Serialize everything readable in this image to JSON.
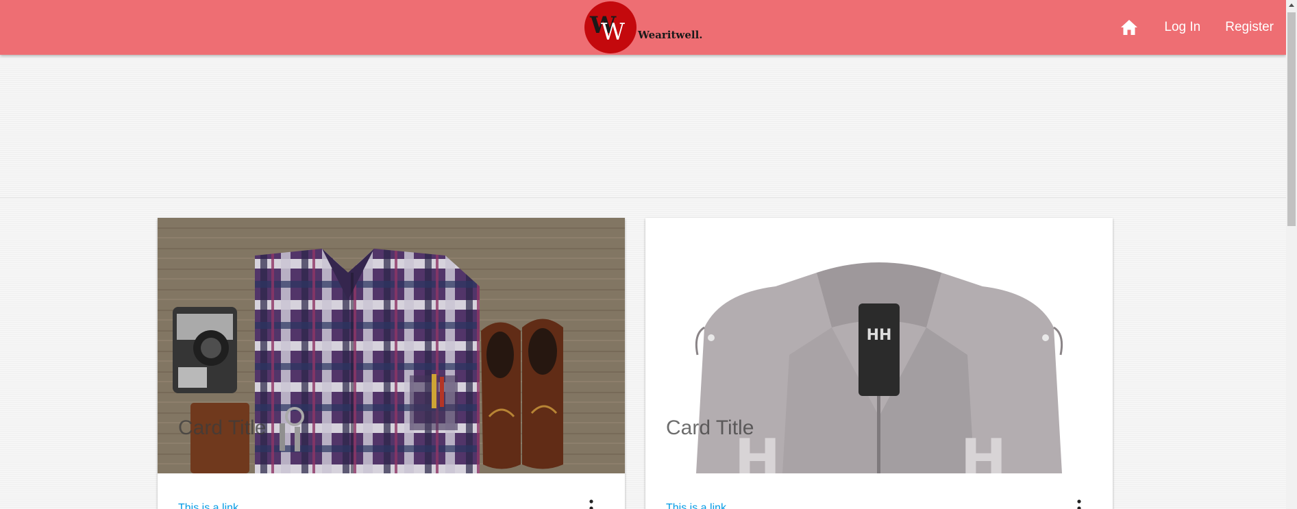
{
  "brand": {
    "name": "Wearitwell.",
    "logo_text": "WW",
    "logo_color": "#c4090d"
  },
  "navbar": {
    "background": "#ee6e73",
    "home_icon": "home-icon",
    "login_label": "Log In",
    "register_label": "Register"
  },
  "cards": [
    {
      "title": "Card Title",
      "link_label": "This is a link",
      "image": "flannel-shirt-flatlay-image",
      "menu_icon": "more-vert-icon"
    },
    {
      "title": "Card Title",
      "link_label": "This is a link",
      "image": "grey-rain-jacket-image",
      "menu_icon": "more-vert-icon"
    }
  ]
}
